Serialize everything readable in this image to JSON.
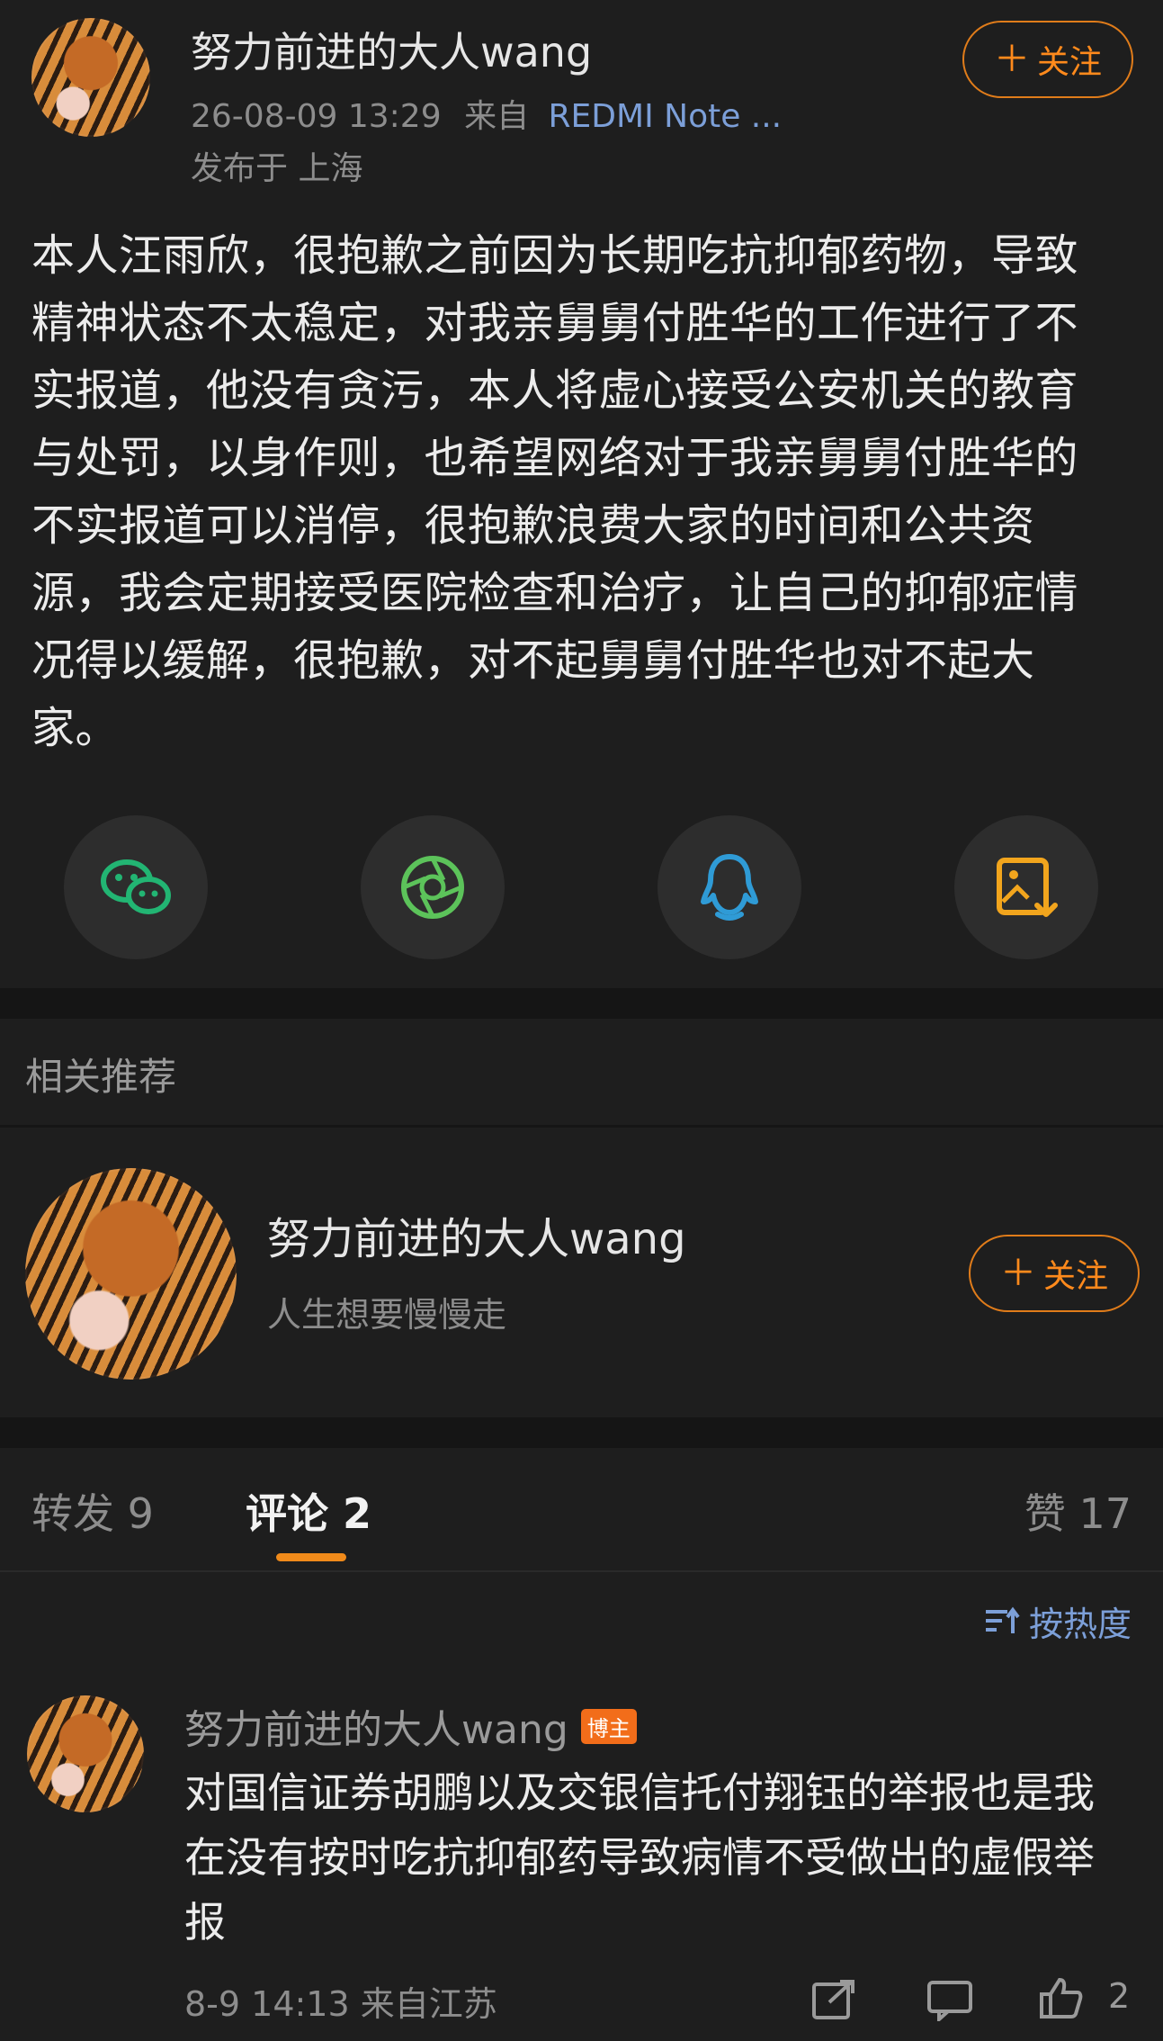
{
  "post": {
    "author": "努力前进的大人wang",
    "time": "26-08-09 13:29",
    "from_label": "来自",
    "device": "REDMI Note ...",
    "location": "发布于 上海",
    "follow_label": "关注",
    "body": "本人汪雨欣，很抱歉之前因为长期吃抗抑郁药物，导致精神状态不太稳定，对我亲舅舅付胜华的工作进行了不实报道，他没有贪污，本人将虚心接受公安机关的教育与处罚，以身作则，也希望网络对于我亲舅舅付胜华的不实报道可以消停，很抱歉浪费大家的时间和公共资源，我会定期接受医院检查和治疗，让自己的抑郁症情况得以缓解，很抱歉，对不起舅舅付胜华也对不起大家。"
  },
  "share": [
    {
      "icon": "wechat-icon",
      "color": "#22b573"
    },
    {
      "icon": "moments-icon",
      "color": "#5cc35a"
    },
    {
      "icon": "qq-icon",
      "color": "#2f9bd6"
    },
    {
      "icon": "save-image-icon",
      "color": "#f2a51d"
    }
  ],
  "related": {
    "header": "相关推荐",
    "name": "努力前进的大人wang",
    "bio": "人生想要慢慢走",
    "follow_label": "关注"
  },
  "tabs": {
    "repost": "转发 9",
    "comments": "评论 2",
    "likes": "赞 17"
  },
  "sort": {
    "label": "按热度"
  },
  "comment": {
    "author": "努力前进的大人wang",
    "badge": "博主",
    "text": "对国信证券胡鹏以及交银信托付翔钰的举报也是我在没有按时吃抗抑郁药导致病情不受做出的虚假举报",
    "meta": "8-9 14:13 来自江苏",
    "like_count": "2"
  },
  "colors": {
    "accent": "#ff8a1c",
    "link": "#7c9fd8",
    "tab_indicator": "#f08a1a"
  }
}
